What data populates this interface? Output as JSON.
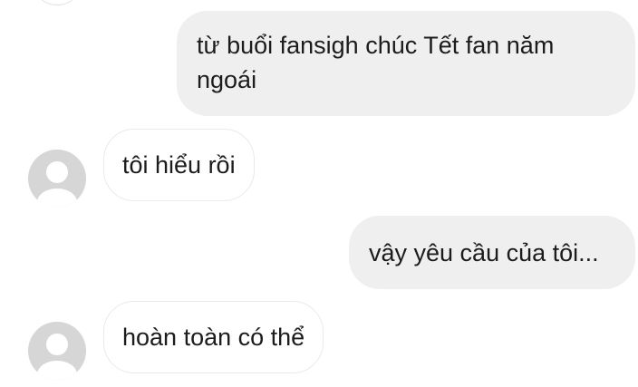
{
  "conversation": {
    "messages": [
      {
        "direction": "outgoing",
        "lines": [
          "từ buổi fansigh chúc Tết fan năm",
          "ngoái"
        ]
      },
      {
        "direction": "incoming",
        "text": "tôi hiểu rồi"
      },
      {
        "direction": "outgoing",
        "text": "vậy yêu cầu của tôi..."
      },
      {
        "direction": "incoming",
        "text": "hoàn toàn có thể"
      }
    ]
  },
  "icons": {
    "avatar": "default-user-avatar-icon"
  },
  "colors": {
    "outgoing_bubble": "#efefef",
    "incoming_bubble_border": "#e9e9e9",
    "avatar_bg": "#d6d6d6",
    "avatar_fg": "#ffffff",
    "text": "#1c1c1c"
  }
}
